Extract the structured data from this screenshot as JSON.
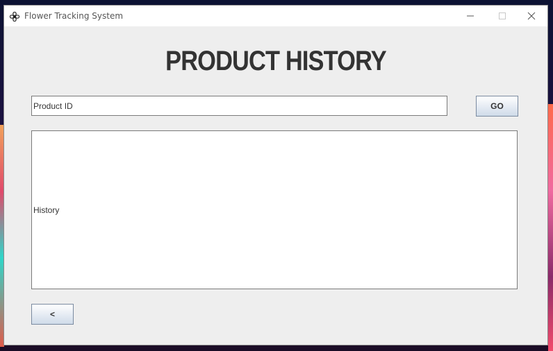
{
  "window": {
    "title": "Flower Tracking System",
    "icon": "flower-icon"
  },
  "page": {
    "heading": "PRODUCT HISTORY"
  },
  "search": {
    "value": "Product ID",
    "go_label": "GO"
  },
  "history": {
    "label": "History"
  },
  "navigation": {
    "back_label": "<"
  },
  "colors": {
    "window_bg": "#eeeeee",
    "heading": "#333333",
    "button_gradient_bottom": "#cfdbe9"
  }
}
